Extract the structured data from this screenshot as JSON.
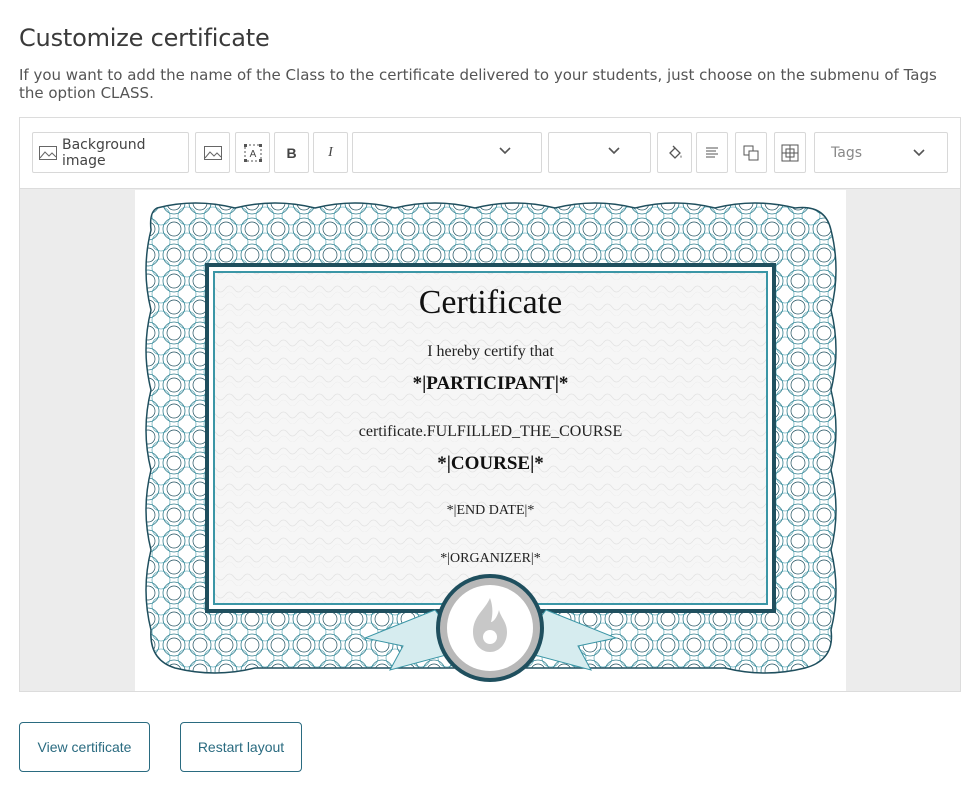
{
  "page": {
    "title": "Customize certificate",
    "intro": "If you want to add the name of the Class to the certificate delivered to your students, just choose on the submenu of Tags the option CLASS."
  },
  "toolbar": {
    "background_image_label": "Background image",
    "bold_label": "B",
    "italic_label": "I",
    "text_box_label": "A",
    "font_family_value": "",
    "font_size_value": "",
    "tags_label": "Tags",
    "icons": {
      "background_image": "image-icon",
      "insert_image": "image-icon",
      "text_box": "text-box-icon",
      "fill_color": "paint-bucket-icon",
      "align": "align-left-icon",
      "layer": "bring-forward-icon",
      "center": "center-element-icon",
      "dropdown": "chevron-down-icon"
    }
  },
  "certificate": {
    "title": "Certificate",
    "certify": "I hereby certify that",
    "participant": "*|PARTICIPANT|*",
    "fulfilled": "certificate.FULFILLED_THE_COURSE",
    "course": "*|COURSE|*",
    "end_date": "*|END DATE|*",
    "organizer": "*|ORGANIZER|*",
    "seal_icon": "flame-icon",
    "colors": {
      "border_dark": "#1f4f5e",
      "border_light": "#3b96a6",
      "seal_gray": "#c8c8c8"
    }
  },
  "actions": {
    "view_label": "View certificate",
    "restart_label": "Restart layout"
  },
  "colors": {
    "accent": "#2a6b80",
    "border": "#dcdcdc"
  }
}
